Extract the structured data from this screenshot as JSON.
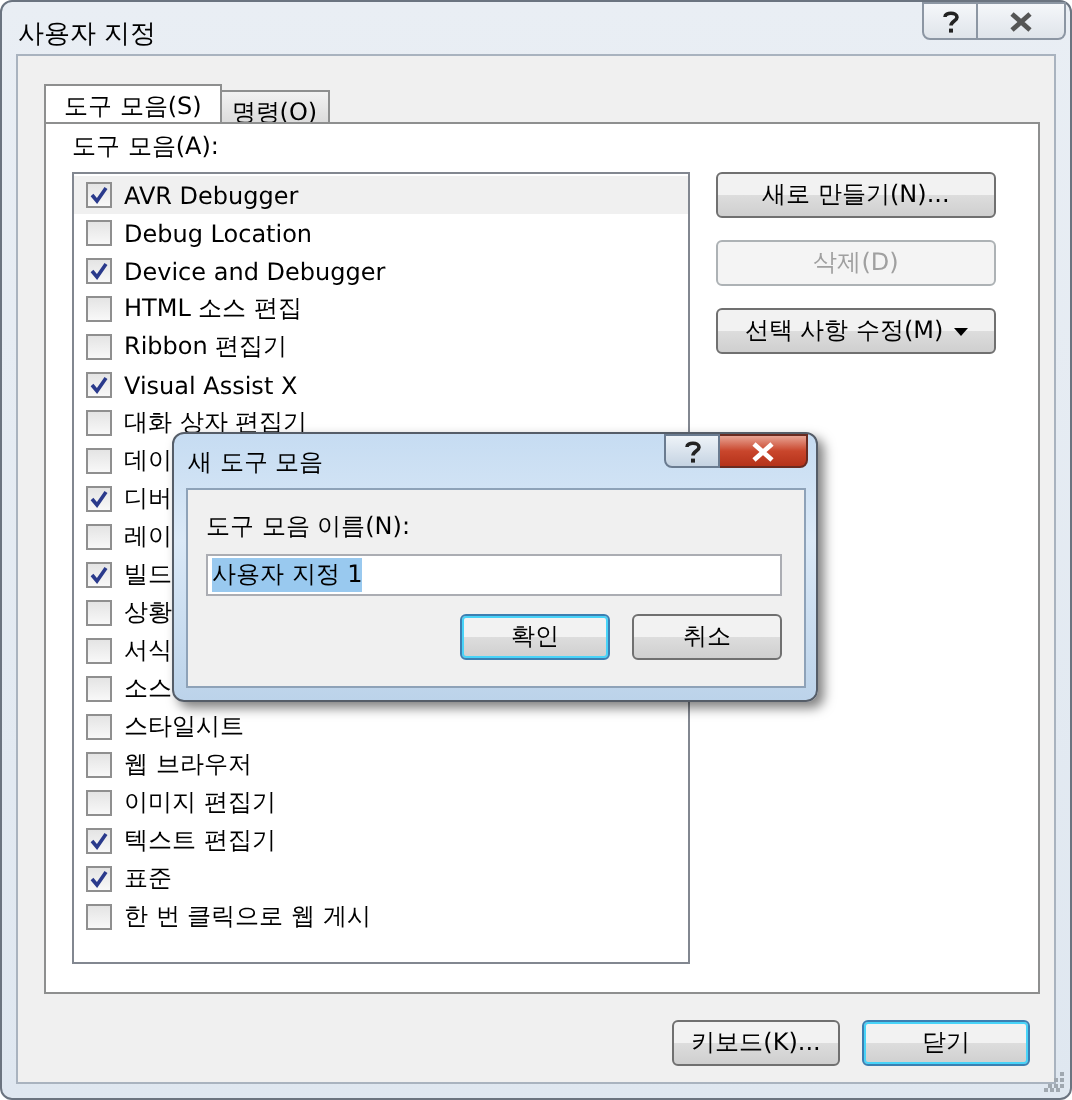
{
  "window": {
    "title": "사용자 지정"
  },
  "tabs": [
    {
      "label": "도구 모음(S)",
      "selected": true
    },
    {
      "label": "명령(O)",
      "selected": false
    }
  ],
  "toolbars_label": "도구 모음(A):",
  "toolbars": [
    {
      "label": "AVR Debugger",
      "checked": true,
      "selected": true
    },
    {
      "label": "Debug Location",
      "checked": false,
      "selected": false
    },
    {
      "label": "Device and Debugger",
      "checked": true,
      "selected": false
    },
    {
      "label": "HTML 소스 편집",
      "checked": false,
      "selected": false
    },
    {
      "label": "Ribbon 편집기",
      "checked": false,
      "selected": false
    },
    {
      "label": "Visual Assist X",
      "checked": true,
      "selected": false
    },
    {
      "label": "대화 상자 편집기",
      "checked": false,
      "selected": false
    },
    {
      "label": "데이",
      "checked": false,
      "selected": false
    },
    {
      "label": "디버",
      "checked": true,
      "selected": false
    },
    {
      "label": "레이",
      "checked": false,
      "selected": false
    },
    {
      "label": "빌드",
      "checked": true,
      "selected": false
    },
    {
      "label": "상황",
      "checked": false,
      "selected": false
    },
    {
      "label": "서식",
      "checked": false,
      "selected": false
    },
    {
      "label": "소스",
      "checked": false,
      "selected": false
    },
    {
      "label": "스타일시트",
      "checked": false,
      "selected": false
    },
    {
      "label": "웹 브라우저",
      "checked": false,
      "selected": false
    },
    {
      "label": "이미지 편집기",
      "checked": false,
      "selected": false
    },
    {
      "label": "텍스트 편집기",
      "checked": true,
      "selected": false
    },
    {
      "label": "표준",
      "checked": true,
      "selected": false
    },
    {
      "label": "한 번 클릭으로 웹 게시",
      "checked": false,
      "selected": false
    }
  ],
  "side_buttons": [
    {
      "label": "새로 만들기(N)...",
      "disabled": false,
      "dropdown": false
    },
    {
      "label": "삭제(D)",
      "disabled": true,
      "dropdown": false
    },
    {
      "label": "선택 사항 수정(M)",
      "disabled": false,
      "dropdown": true
    }
  ],
  "bottom_buttons": [
    {
      "label": "키보드(K)...",
      "default": false
    },
    {
      "label": "닫기",
      "default": true
    }
  ],
  "dialog": {
    "title": "새 도구 모음",
    "field_label": "도구 모음 이름(N):",
    "value": "사용자 지정 1",
    "buttons": [
      {
        "label": "확인",
        "default": true
      },
      {
        "label": "취소",
        "default": false
      }
    ]
  }
}
